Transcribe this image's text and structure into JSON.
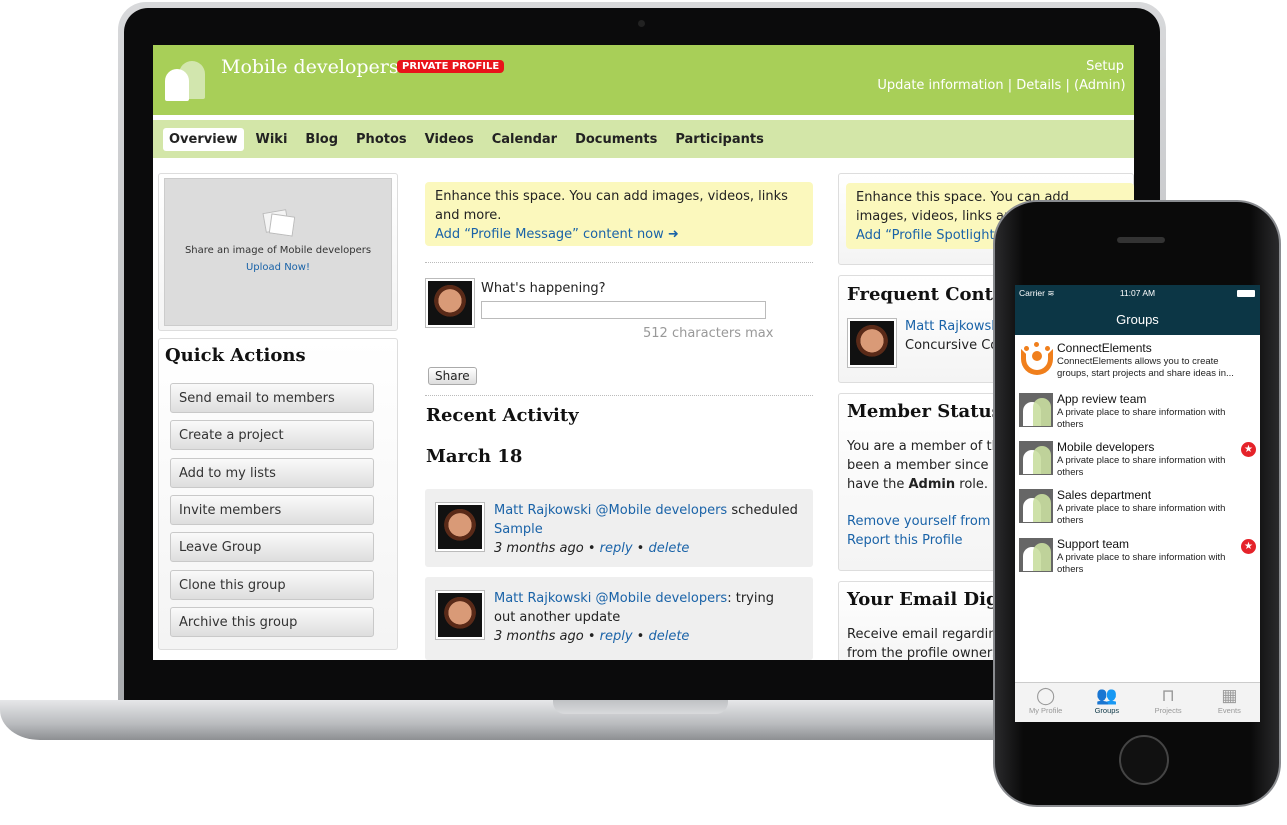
{
  "laptop": {
    "header": {
      "title": "Mobile developers",
      "badge": "PRIVATE PROFILE",
      "links": [
        "Update information",
        "Details",
        "Setup (Admin)"
      ],
      "separator": "|"
    },
    "nav": [
      "Overview",
      "Wiki",
      "Blog",
      "Photos",
      "Videos",
      "Calendar",
      "Documents",
      "Participants"
    ],
    "image_box": {
      "text": "Share an image of Mobile developers",
      "link": "Upload Now!"
    },
    "quick_actions": {
      "title": "Quick Actions",
      "buttons": [
        "Send email to members",
        "Create a project",
        "Add to my lists",
        "Invite members",
        "Leave Group",
        "Clone this group",
        "Archive this group"
      ]
    },
    "enhance_center": {
      "text": "Enhance this space. You can add images, videos, links and more.",
      "link": "Add “Profile Message” content now"
    },
    "status": {
      "label": "What's happening?",
      "value": "",
      "hint": "512 characters max",
      "share": "Share"
    },
    "recent": {
      "title": "Recent Activity",
      "date": "March 18",
      "items": [
        {
          "user": "Matt Rajkowski",
          "group": "@Mobile developers",
          "text": "scheduled",
          "link": "Sample",
          "time": "3 months ago",
          "reply": "reply",
          "delete": "delete"
        },
        {
          "user": "Matt Rajkowski",
          "group": "@Mobile developers",
          "text": ": trying out another update",
          "link": "",
          "time": "3 months ago",
          "reply": "reply",
          "delete": "delete"
        }
      ]
    },
    "enhance_right": {
      "text": "Enhance this space. You can add images, videos, links and more.",
      "link": "Add “Profile Spotlight”"
    },
    "frequent": {
      "title": "Frequent Cont",
      "name": "Matt Rajkowski",
      "org": "Concursive Co"
    },
    "member": {
      "title": "Member Status",
      "line1": "You are a member of th",
      "line2": "been a member since 1",
      "line3a": "have the ",
      "line3b": "Admin",
      "line3c": " role.",
      "remove": "Remove yourself from M",
      "report": "Report this Profile"
    },
    "email": {
      "title": "Your Email Dig",
      "line1": "Receive email regarding",
      "line2": "from the profile owners'"
    }
  },
  "phone": {
    "status": {
      "carrier": "Carrier",
      "time": "11:07 AM"
    },
    "title": "Groups",
    "groups": [
      {
        "name": "ConnectElements",
        "desc": "ConnectElements allows you to create groups, start projects and share ideas in...",
        "starred": false
      },
      {
        "name": "App review team",
        "desc": "A private place to share information with others",
        "starred": false
      },
      {
        "name": "Mobile developers",
        "desc": "A private place to share information with others",
        "starred": true
      },
      {
        "name": "Sales department",
        "desc": "A private place to share information with others",
        "starred": false
      },
      {
        "name": "Support team",
        "desc": "A private place to share information with others",
        "starred": true
      }
    ],
    "tabs": [
      {
        "label": "My Profile",
        "icon": "person-icon"
      },
      {
        "label": "Groups",
        "icon": "groups-icon",
        "active": true
      },
      {
        "label": "Projects",
        "icon": "inbox-icon"
      },
      {
        "label": "Events",
        "icon": "calendar-icon"
      }
    ],
    "colors": {
      "bar": "#0c3645",
      "accent": "#f07f1c",
      "star": "#e5232a"
    }
  },
  "colors": {
    "header": "#a8cf58",
    "nav": "#d3e6a8",
    "link": "#1a63a8",
    "badge": "#e8141a"
  }
}
